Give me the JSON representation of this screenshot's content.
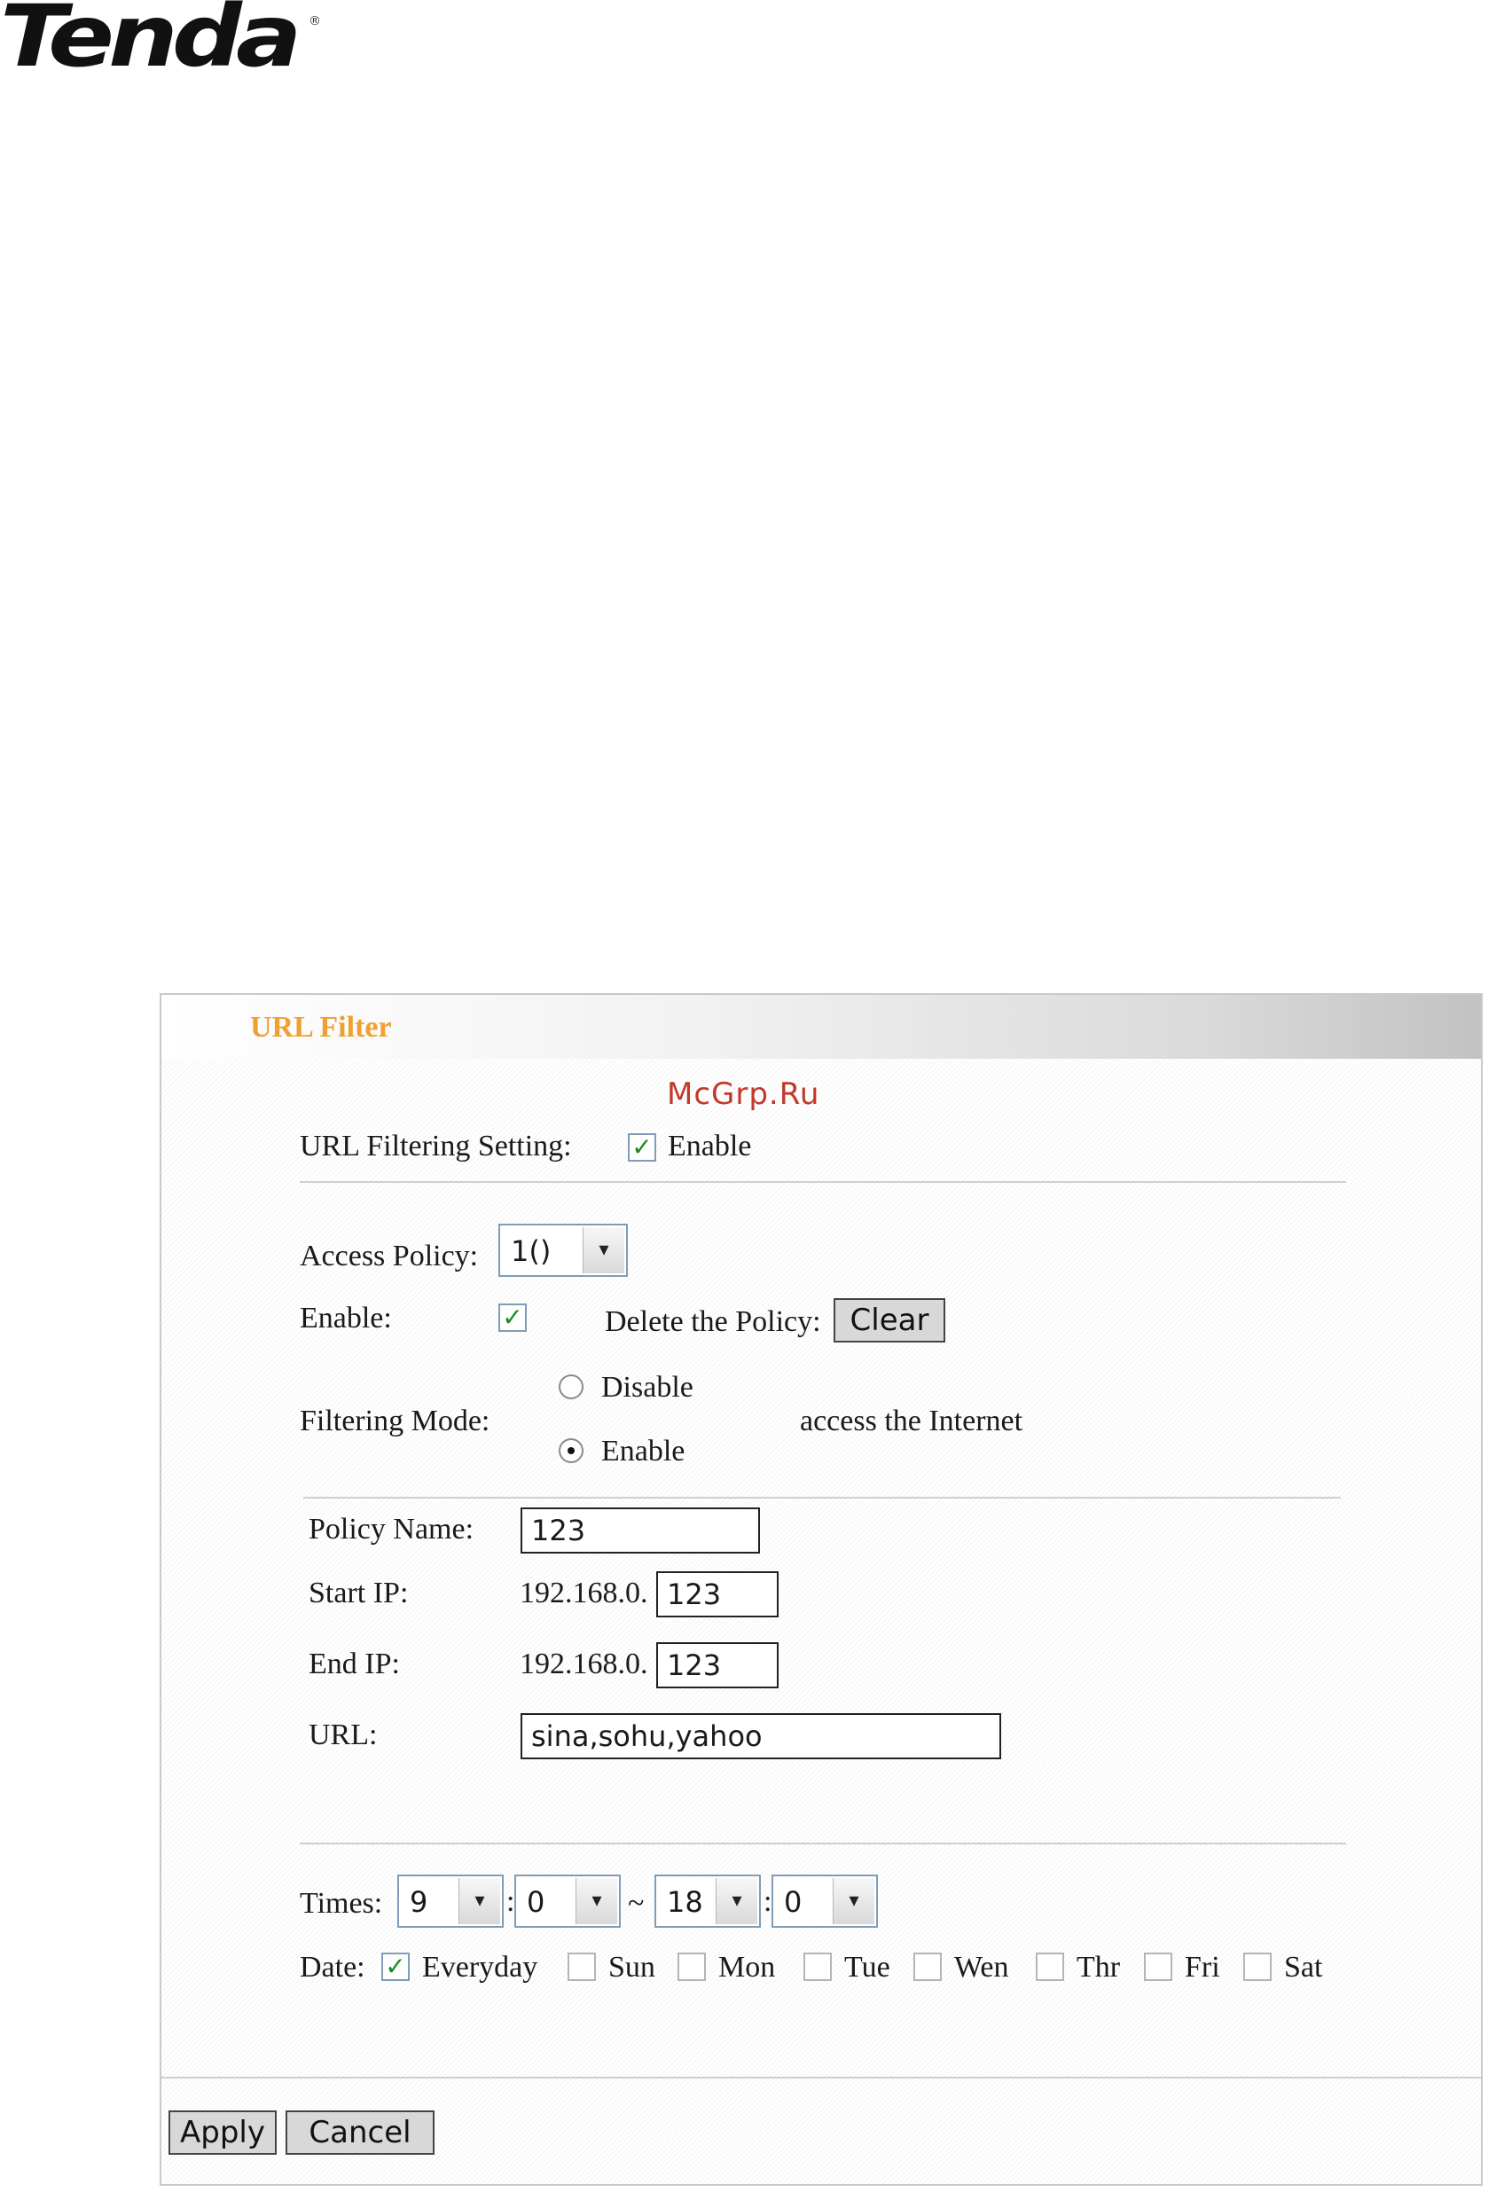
{
  "brand": {
    "logo_text": "Tenda",
    "reg_mark": "®"
  },
  "watermark": "McGrp.Ru",
  "panel": {
    "title": "URL Filter"
  },
  "url_filtering": {
    "label": "URL Filtering Setting:",
    "enable_label": "Enable",
    "enabled": true
  },
  "access_policy": {
    "label": "Access Policy:",
    "selected": "1()"
  },
  "policy_enable": {
    "label": "Enable:",
    "checked": true
  },
  "delete_policy": {
    "label": "Delete the Policy:",
    "button": "Clear"
  },
  "filtering_mode": {
    "label": "Filtering Mode:",
    "options": [
      "Disable",
      "Enable"
    ],
    "selected": "Enable",
    "suffix": "access the Internet"
  },
  "policy_name": {
    "label": "Policy Name:",
    "value": "123"
  },
  "start_ip": {
    "label": "Start IP:",
    "prefix": "192.168.0.",
    "value": "123"
  },
  "end_ip": {
    "label": "End IP:",
    "prefix": "192.168.0.",
    "value": "123"
  },
  "url": {
    "label": "URL:",
    "value": "sina,sohu,yahoo"
  },
  "times": {
    "label": "Times:",
    "start_hour": "9",
    "start_min": "0",
    "separator": "~",
    "colon": ":",
    "end_hour": "18",
    "end_min": "0"
  },
  "date": {
    "label": "Date:",
    "days": [
      {
        "label": "Everyday",
        "checked": true
      },
      {
        "label": "Sun",
        "checked": false
      },
      {
        "label": "Mon",
        "checked": false
      },
      {
        "label": "Tue",
        "checked": false
      },
      {
        "label": "Wen",
        "checked": false
      },
      {
        "label": "Thr",
        "checked": false
      },
      {
        "label": "Fri",
        "checked": false
      },
      {
        "label": "Sat",
        "checked": false
      }
    ]
  },
  "actions": {
    "apply": "Apply",
    "cancel": "Cancel"
  },
  "glyphs": {
    "check": "✓",
    "dropdown": "▾"
  }
}
